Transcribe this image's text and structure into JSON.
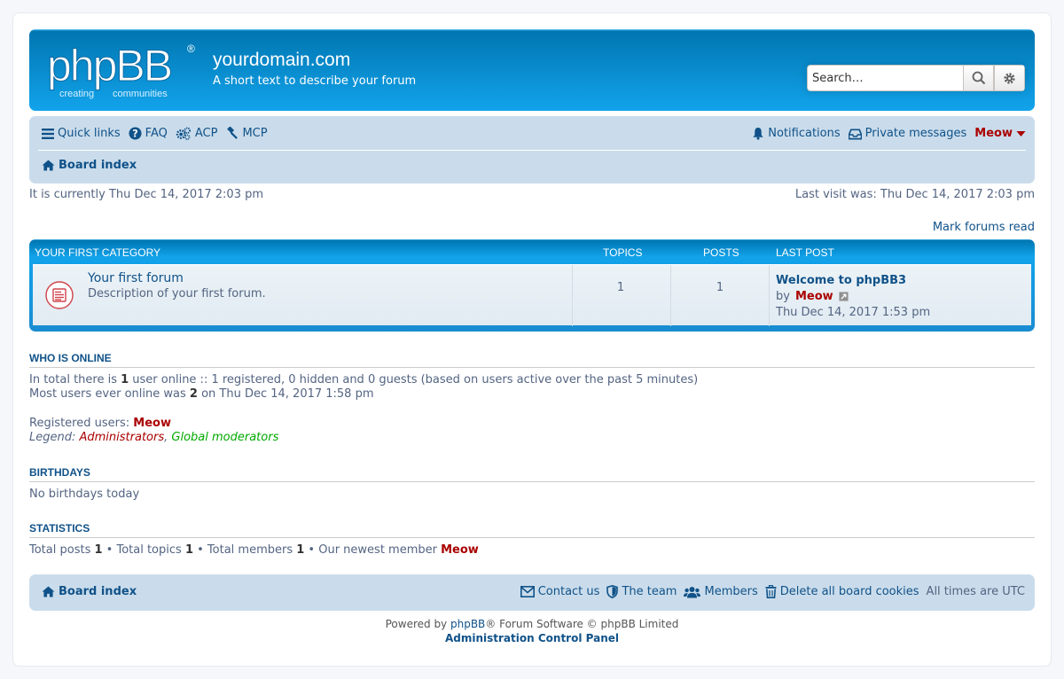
{
  "header": {
    "logo_text": "phpBB",
    "logo_tagline_1": "creating",
    "logo_tagline_2": "communities",
    "site_title": "yourdomain.com",
    "site_description": "A short text to describe your forum",
    "search_placeholder": "Search…"
  },
  "navbar": {
    "quick_links": "Quick links",
    "faq": "FAQ",
    "acp": "ACP",
    "mcp": "MCP",
    "notifications": "Notifications",
    "private_messages": "Private messages",
    "username": "Meow",
    "breadcrumb": "Board index"
  },
  "times": {
    "current": "It is currently Thu Dec 14, 2017 2:03 pm",
    "last_visit": "Last visit was: Thu Dec 14, 2017 2:03 pm"
  },
  "mark_forums_read": "Mark forums read",
  "category": {
    "name": "YOUR FIRST CATEGORY",
    "col_topics": "TOPICS",
    "col_posts": "POSTS",
    "col_last_post": "LAST POST",
    "forums": [
      {
        "title": "Your first forum",
        "description": "Description of your first forum.",
        "topics": "1",
        "posts": "1",
        "last_post_title": "Welcome to phpBB3",
        "last_post_by_label": "by",
        "last_post_author": "Meow",
        "last_post_time": "Thu Dec 14, 2017 1:53 pm"
      }
    ]
  },
  "who_is_online": {
    "title": "WHO IS ONLINE",
    "line1_a": "In total there is ",
    "line1_count": "1",
    "line1_b": " user online :: 1 registered, 0 hidden and 0 guests (based on users active over the past 5 minutes)",
    "line2_a": "Most users ever online was ",
    "line2_count": "2",
    "line2_b": " on Thu Dec 14, 2017 1:58 pm",
    "registered_label": "Registered users: ",
    "registered_user": "Meow",
    "legend_label": "Legend: ",
    "legend_admins": "Administrators",
    "legend_sep": ", ",
    "legend_gmods": "Global moderators"
  },
  "birthdays": {
    "title": "BIRTHDAYS",
    "text": "No birthdays today"
  },
  "statistics": {
    "title": "STATISTICS",
    "posts_label": "Total posts ",
    "posts": "1",
    "topics_label": " • Total topics ",
    "topics": "1",
    "members_label": " • Total members ",
    "members": "1",
    "newest_label": " • Our newest member ",
    "newest_member": "Meow"
  },
  "footer": {
    "board_index": "Board index",
    "contact_us": "Contact us",
    "the_team": "The team",
    "members": "Members",
    "delete_cookies": "Delete all board cookies",
    "timezone": "All times are UTC",
    "powered_a": "Powered by ",
    "powered_link": "phpBB",
    "powered_b": "® Forum Software © phpBB Limited",
    "acp_link": "Administration Control Panel"
  },
  "colors": {
    "link": "#105289",
    "username": "#aa0000",
    "global_mod": "#00aa00",
    "header_blue": "#12a3eb",
    "navbar_bg": "#cadceb"
  }
}
